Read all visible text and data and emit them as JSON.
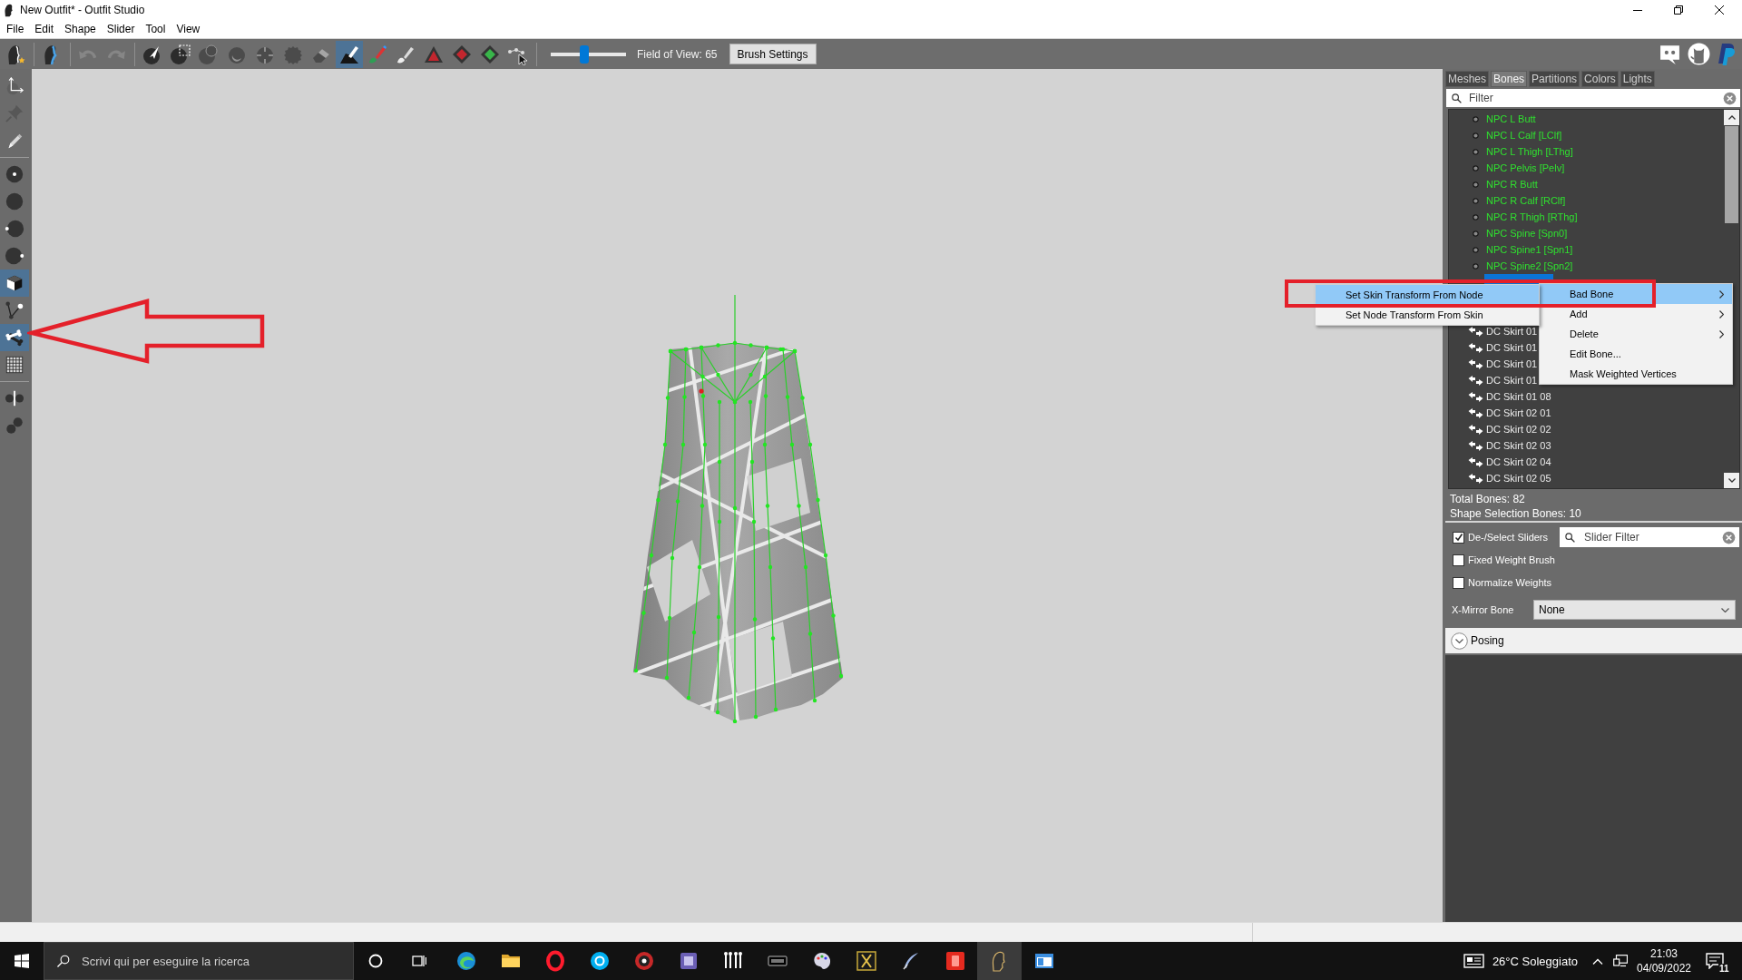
{
  "window": {
    "title": "New Outfit* - Outfit Studio"
  },
  "menu_bar": [
    "File",
    "Edit",
    "Shape",
    "Slider",
    "Tool",
    "View"
  ],
  "toolbar": {
    "groups": [
      [
        {
          "kind": "project",
          "selected": false,
          "disabled": false
        }
      ],
      [
        {
          "kind": "reference",
          "selected": false,
          "disabled": false
        }
      ],
      [
        {
          "kind": "undo",
          "selected": false,
          "disabled": true
        },
        {
          "kind": "redo",
          "selected": false,
          "disabled": true
        }
      ],
      [
        {
          "kind": "select",
          "selected": false,
          "disabled": false
        },
        {
          "kind": "mask",
          "selected": false,
          "disabled": false
        },
        {
          "kind": "inflate",
          "selected": false,
          "disabled": true
        },
        {
          "kind": "deflate",
          "selected": false,
          "disabled": true
        },
        {
          "kind": "move",
          "selected": false,
          "disabled": true
        },
        {
          "kind": "smooth",
          "selected": false,
          "disabled": true
        },
        {
          "kind": "eraser",
          "selected": false,
          "disabled": true
        },
        {
          "kind": "weight",
          "selected": true,
          "disabled": false
        },
        {
          "kind": "paint",
          "selected": false,
          "disabled": false
        },
        {
          "kind": "alpha",
          "selected": false,
          "disabled": false
        },
        {
          "kind": "collapse",
          "selected": false,
          "disabled": false
        },
        {
          "kind": "flip",
          "selected": false,
          "disabled": false
        },
        {
          "kind": "split",
          "selected": false,
          "disabled": false
        },
        {
          "kind": "connect",
          "selected": false,
          "disabled": false
        }
      ]
    ],
    "fov_slider": {
      "level": 0.45
    },
    "fov_label": "Field of View: 65",
    "brush_settings": "Brush Settings"
  },
  "left_tools": {
    "groups": [
      [
        {
          "kind": "axes",
          "selected": false,
          "disabled": false
        },
        {
          "kind": "pin",
          "selected": false,
          "disabled": true
        },
        {
          "kind": "pencil",
          "selected": false,
          "disabled": false
        }
      ],
      [
        {
          "kind": "center",
          "selected": false,
          "disabled": false
        },
        {
          "kind": "plain",
          "selected": false,
          "disabled": false
        },
        {
          "kind": "left",
          "selected": false,
          "disabled": false
        },
        {
          "kind": "right",
          "selected": false,
          "disabled": false
        },
        {
          "kind": "cube",
          "selected": true,
          "disabled": false
        },
        {
          "kind": "vertices",
          "selected": false,
          "disabled": false
        },
        {
          "kind": "bone",
          "selected": true,
          "disabled": false
        },
        {
          "kind": "grid",
          "selected": false,
          "disabled": false
        }
      ],
      [
        {
          "kind": "mirror",
          "selected": false,
          "disabled": false
        },
        {
          "kind": "pair",
          "selected": false,
          "disabled": false
        }
      ]
    ]
  },
  "right_panel": {
    "tabs": [
      {
        "label": "Meshes",
        "selected": false
      },
      {
        "label": "Bones",
        "selected": true
      },
      {
        "label": "Partitions",
        "selected": false
      },
      {
        "label": "Colors",
        "selected": false
      },
      {
        "label": "Lights",
        "selected": false
      }
    ],
    "filter": {
      "placeholder": "Filter"
    },
    "bone_list": {
      "rows": [
        {
          "kind": "node",
          "label": "NPC L Butt",
          "selected": false
        },
        {
          "kind": "node",
          "label": "NPC L Calf [LClf]",
          "selected": false
        },
        {
          "kind": "node",
          "label": "NPC L Thigh [LThg]",
          "selected": false
        },
        {
          "kind": "node",
          "label": "NPC Pelvis [Pelv]",
          "selected": false
        },
        {
          "kind": "node",
          "label": "NPC R Butt",
          "selected": false
        },
        {
          "kind": "node",
          "label": "NPC R Calf [RClf]",
          "selected": false
        },
        {
          "kind": "node",
          "label": "NPC R Thigh [RThg]",
          "selected": false
        },
        {
          "kind": "node",
          "label": "NPC Spine [Spn0]",
          "selected": false
        },
        {
          "kind": "node",
          "label": "NPC Spine1 [Spn1]",
          "selected": false
        },
        {
          "kind": "node",
          "label": "NPC Spine2 [Spn2]",
          "selected": false
        },
        {
          "selected": true
        }
      ],
      "rows_below_menu": [
        {
          "kind": "bone",
          "label": "DC Skirt 01",
          "selected": false
        },
        {
          "kind": "bone",
          "label": "DC Skirt 01",
          "selected": false
        },
        {
          "kind": "bone",
          "label": "DC Skirt 01",
          "selected": false
        },
        {
          "kind": "bone",
          "label": "DC Skirt 01",
          "selected": false
        },
        {
          "kind": "bone",
          "label": "DC Skirt 01 08",
          "selected": false
        },
        {
          "kind": "bone",
          "label": "DC Skirt 02 01",
          "selected": false
        },
        {
          "kind": "bone",
          "label": "DC Skirt 02 02",
          "selected": false
        },
        {
          "kind": "bone",
          "label": "DC Skirt 02 03",
          "selected": false
        },
        {
          "kind": "bone",
          "label": "DC Skirt 02 04",
          "selected": false
        },
        {
          "kind": "bone",
          "label": "DC Skirt 02 05",
          "selected": false
        }
      ]
    },
    "total_bones": "Total Bones: 82",
    "shape_selection_bones": "Shape Selection Bones: 10",
    "options": [
      {
        "label": "De-/Select Sliders",
        "checked": true
      },
      {
        "label": "Fixed Weight Brush",
        "checked": false
      },
      {
        "label": "Normalize Weights",
        "checked": false
      }
    ],
    "slider_filter": {
      "placeholder": "Slider Filter"
    },
    "x_mirror_bone": {
      "label": "X-Mirror Bone",
      "value": "None"
    },
    "posing": {
      "label": "Posing",
      "expanded": false
    }
  },
  "context_menu": {
    "items": [
      {
        "label": "Bad Bone",
        "selected": true,
        "has_submenu": true
      },
      {
        "label": "Add",
        "selected": false,
        "has_submenu": true
      },
      {
        "label": "Delete",
        "selected": false,
        "has_submenu": true
      },
      {
        "label": "Edit Bone...",
        "selected": false,
        "has_submenu": false
      },
      {
        "label": "Mask Weighted Vertices",
        "selected": false,
        "has_submenu": false
      }
    ],
    "submenu": {
      "items": [
        {
          "label": "Set Skin Transform From Node",
          "selected": true
        },
        {
          "label": "Set Node Transform From Skin",
          "selected": false
        }
      ]
    }
  },
  "taskbar": {
    "search": {
      "placeholder": "Scrivi qui per eseguire la ricerca"
    },
    "apps": [
      {
        "kind": "swirl",
        "selected": false
      },
      {
        "kind": "folder",
        "selected": false
      },
      {
        "kind": "ring",
        "selected": false
      },
      {
        "kind": "round",
        "selected": false
      },
      {
        "kind": "target",
        "selected": false
      },
      {
        "kind": "box",
        "selected": false
      },
      {
        "kind": "bars",
        "selected": false
      },
      {
        "kind": "dark",
        "selected": false
      },
      {
        "kind": "palette",
        "selected": false
      },
      {
        "kind": "emblem",
        "selected": false
      },
      {
        "kind": "quill",
        "selected": false
      },
      {
        "kind": "tile",
        "selected": false
      },
      {
        "kind": "figure",
        "selected": true
      },
      {
        "kind": "window",
        "selected": false
      }
    ],
    "weather": "26°C Soleggiato",
    "time": "21:03",
    "date": "04/09/2022",
    "notifications": "11"
  }
}
